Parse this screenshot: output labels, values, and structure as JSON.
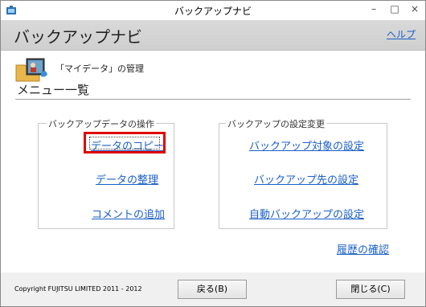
{
  "window": {
    "title": "バックアップナビ",
    "controls": {
      "minimize": "–",
      "maximize": "□",
      "close": "×"
    }
  },
  "header": {
    "app_title": "バックアップナビ",
    "help_link": "ヘルプ"
  },
  "content": {
    "manage_label": "「マイデータ」の管理",
    "section_title": "メニュー一覧",
    "groups": [
      {
        "label": "バックアップデータの操作",
        "links": [
          "データのコピー",
          "データの整理",
          "コメントの追加"
        ]
      },
      {
        "label": "バックアップの設定変更",
        "links": [
          "バックアップ対象の設定",
          "バックアップ先の設定",
          "自動バックアップの設定"
        ]
      }
    ],
    "history_link": "履歴の確認"
  },
  "footer": {
    "copyright": "Copyright FUJITSU LIMITED 2011 - 2012",
    "back_button": "戻る(B)",
    "close_button": "閉じる(C)"
  },
  "colors": {
    "link": "#1a5fc8",
    "highlight": "#e00000",
    "header_bg": "#d3d3d3"
  }
}
